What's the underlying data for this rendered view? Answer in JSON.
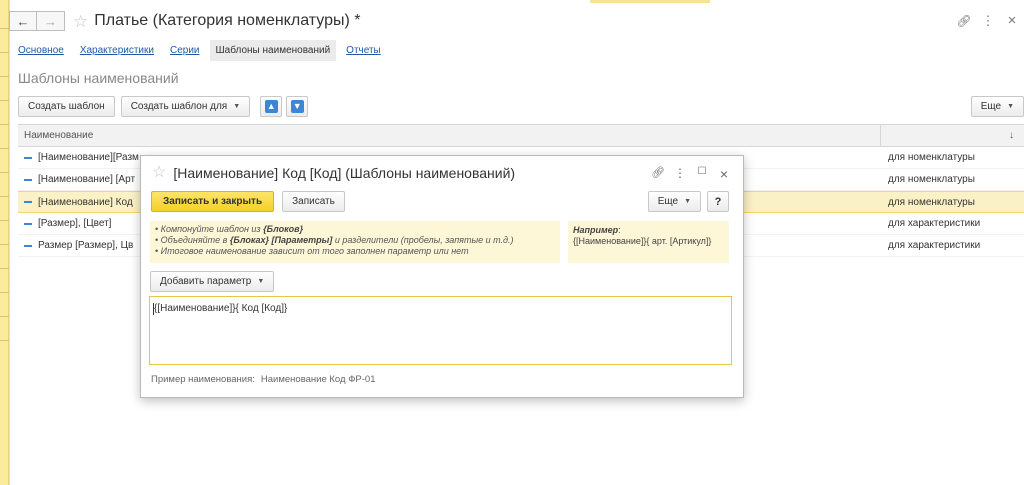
{
  "window": {
    "title": "Платье (Категория номенклатуры) *",
    "back_glyph": "←",
    "forward_glyph": "→",
    "link_glyph": "🔗",
    "menu_glyph": "⋮",
    "close_glyph": "×"
  },
  "tabs": [
    {
      "label": "Основное"
    },
    {
      "label": "Характеристики"
    },
    {
      "label": "Серии"
    },
    {
      "label": "Шаблоны наименований"
    },
    {
      "label": "Отчеты"
    }
  ],
  "section_title": "Шаблоны наименований",
  "toolbar": {
    "create_label": "Создать шаблон",
    "create_for_label": "Создать шаблон для",
    "up_glyph": "⬆",
    "down_glyph": "⬇",
    "more_label": "Еще"
  },
  "table": {
    "columns": [
      "Наименование",
      ""
    ],
    "sort_glyph": "↓",
    "rows": [
      {
        "name": "[Наименование][Разм",
        "target": "для номенклатуры"
      },
      {
        "name": "[Наименование] [Арт",
        "target": "для номенклатуры"
      },
      {
        "name": "[Наименование] Код",
        "target": "для номенклатуры"
      },
      {
        "name": "[Размер], [Цвет]",
        "target": "для характеристики"
      },
      {
        "name": "Размер [Размер], Цв",
        "target": "для характеристики"
      }
    ]
  },
  "dialog": {
    "title": "[Наименование] Код [Код] (Шаблоны наименований)",
    "save_close_label": "Записать и закрыть",
    "save_label": "Записать",
    "more_label": "Еще",
    "help_label": "?",
    "hint_lines": [
      {
        "pre": "• Компонуйте шаблон из ",
        "bold": "{Блоков}",
        "post": ""
      },
      {
        "pre": "• Объединяйте в ",
        "bold": "{Блоках} [Параметры]",
        "post": " и разделители (пробелы, запятые и т.д.)"
      },
      {
        "pre": "• Итоговое наименование зависит от того заполнен параметр или нет",
        "bold": "",
        "post": ""
      }
    ],
    "example_header": "Например",
    "example_value": "{[Наименование]}{ арт. [Артикул]}",
    "add_param_label": "Добавить параметр",
    "template_value": "{[Наименование]}{ Код [Код]}",
    "sample_label": "Пример наименования:",
    "sample_value": "Наименование Код ФР-01"
  },
  "colors": {
    "accent_yellow": "#f4d028",
    "selection": "#fbf1c6",
    "link": "#1f59a8",
    "arrow_blue": "#3d86d6"
  }
}
